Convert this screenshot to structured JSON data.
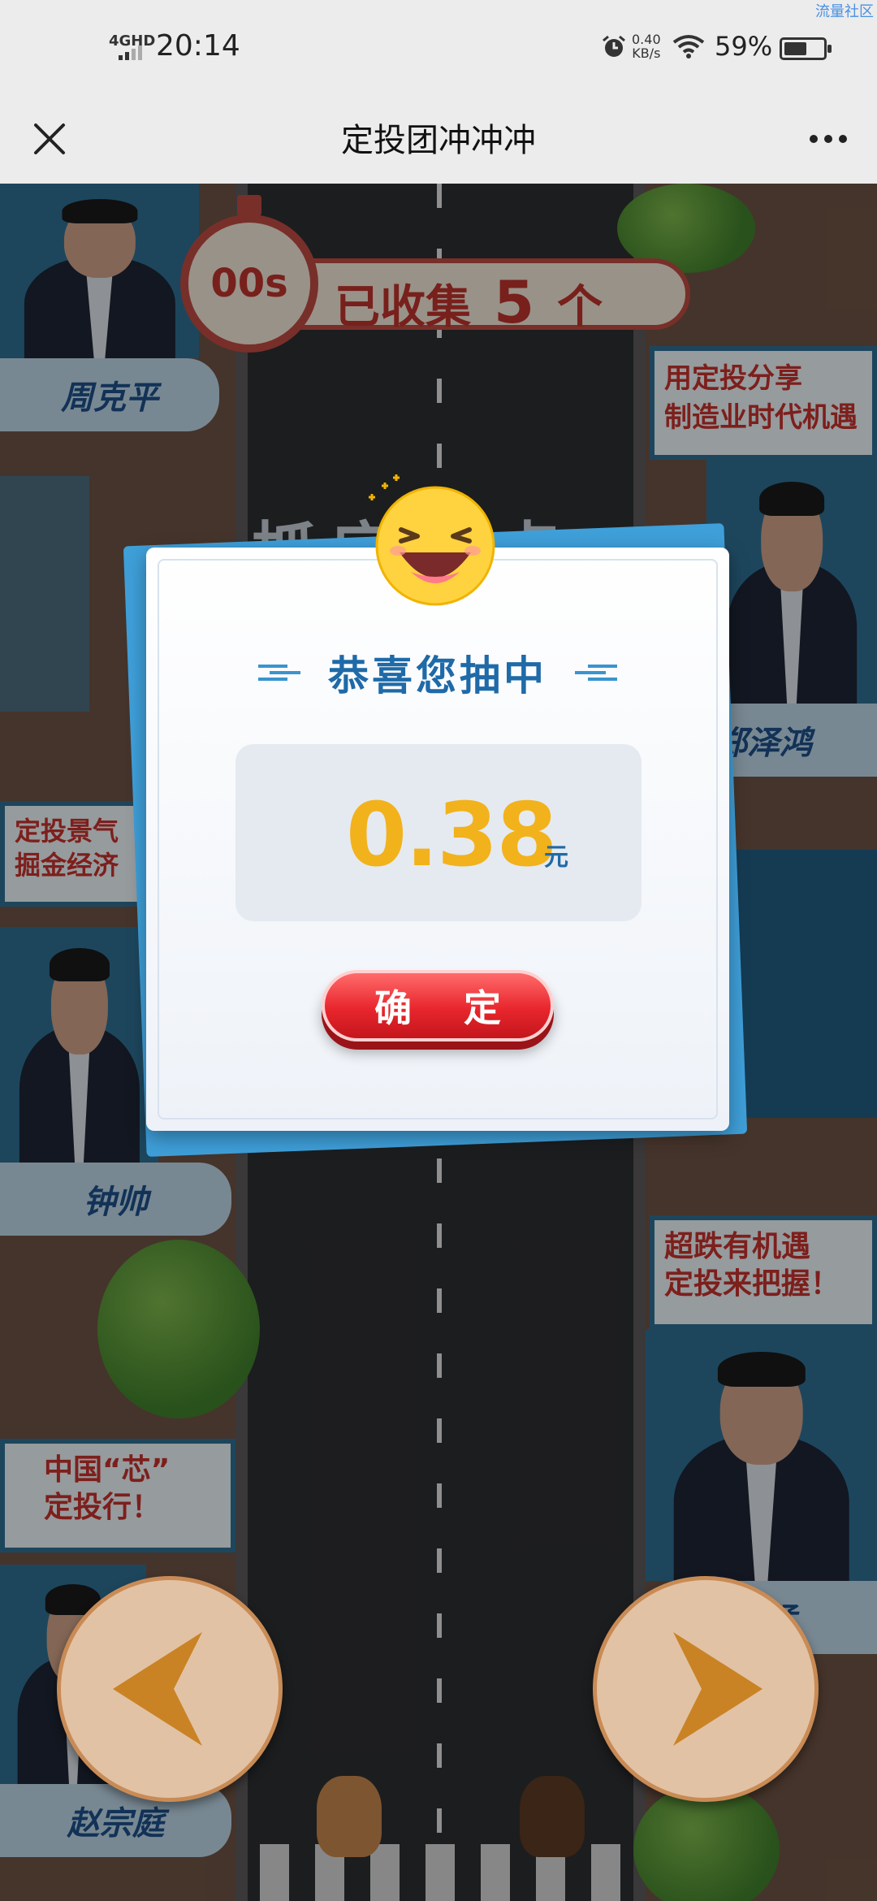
{
  "status_bar": {
    "watermark": "流量社区",
    "network": "4GHD",
    "time": "20:14",
    "net_speed_value": "0.40",
    "net_speed_unit": "KB/s",
    "battery_percent": "59%",
    "battery_level": 0.59
  },
  "nav": {
    "title": "定投团冲冲冲",
    "close_icon": "close-icon",
    "more_icon": "more-icon"
  },
  "game": {
    "timer": "00s",
    "collected_prefix": "已收集",
    "collected_count": "5",
    "collected_suffix": "个",
    "banner": "抓定投点",
    "managers": {
      "top_left": "周克平",
      "mid_right": "郑泽鸿",
      "mid_left": "钟帅",
      "bottom_right": "猛",
      "bottom_left": "赵宗庭"
    },
    "signs": {
      "right_1_line1": "用定投分享",
      "right_1_line2": "制造业时代机遇",
      "left_1_line1": "定投景气",
      "left_1_line2": "掘金经济",
      "right_2_line1": "超跌有机遇",
      "right_2_line2": "定投来把握！",
      "left_2_line1": "中国“芯”",
      "left_2_line2": "定投行！"
    },
    "left_button_icon": "chevron-left-icon",
    "right_button_icon": "chevron-right-icon"
  },
  "modal": {
    "title": "恭喜您抽中",
    "amount": "0.38",
    "unit": "元",
    "confirm_label": "确 定",
    "emoji_icon": "laughing-emoji-icon"
  },
  "colors": {
    "accent_blue": "#1f6aa8",
    "prize_gold": "#f2b21b",
    "button_red": "#e8262d",
    "timer_red": "#b8322b"
  }
}
